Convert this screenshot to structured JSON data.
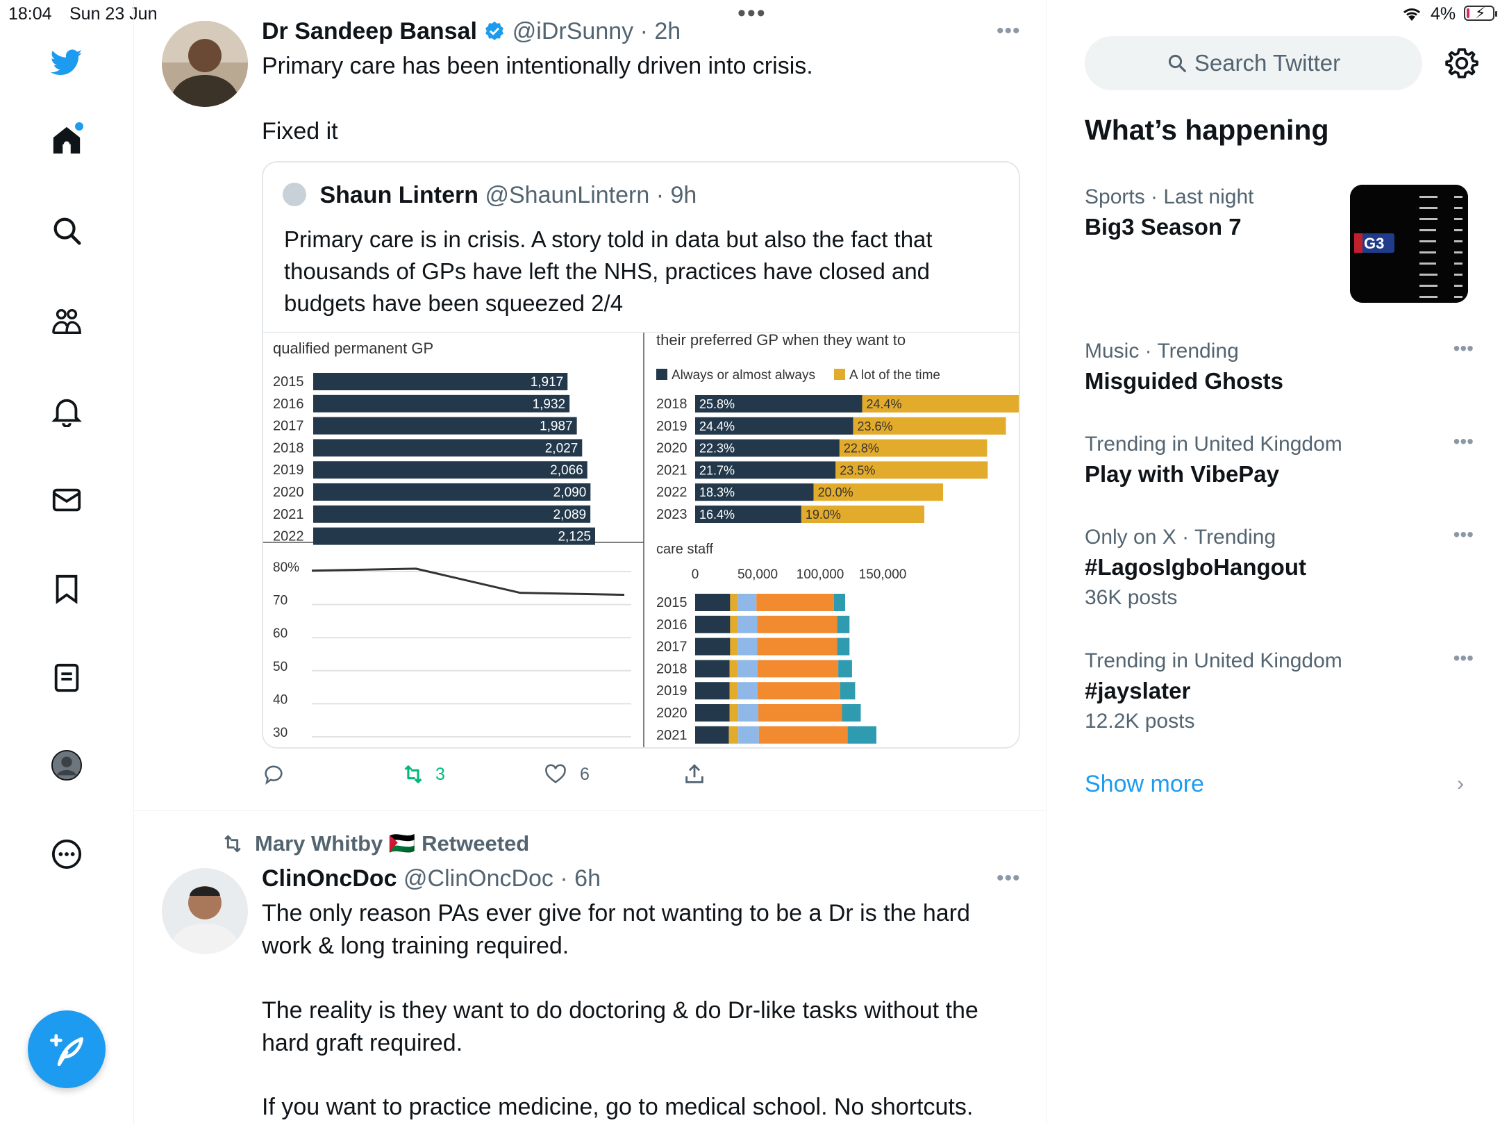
{
  "status_bar": {
    "time": "18:04",
    "date": "Sun 23 Jun",
    "battery": "4%",
    "battery_level": 0.04
  },
  "nav": {
    "compose_label": "Post"
  },
  "tweet1": {
    "name": "Dr Sandeep Bansal",
    "handle": "@iDrSunny",
    "time": "· 2h",
    "text_line1": "Primary care has been intentionally driven into crisis.",
    "text_line2": "Fixed it",
    "quote": {
      "name": "Shaun Lintern",
      "handle": "@ShaunLintern",
      "time": "· 9h",
      "text": "Primary care is in crisis. A story told in data but also the fact that thousands of GPs have left the NHS, practices have closed and budgets have been squeezed 2/4"
    },
    "retweets": "3",
    "likes": "6"
  },
  "tweet2": {
    "retweeted_by": "Mary Whitby",
    "flag": "🇵🇸",
    "retweeted_label": "Retweeted",
    "name": "ClinOncDoc",
    "handle": "@ClinOncDoc",
    "time": "· 6h",
    "p1a": "The only reason PAs ever give for not wanting to be a Dr is the hard",
    "p1b": "work & long training required.",
    "p2a": "The reality is they want to do doctoring & do Dr-like tasks without the",
    "p2b": "hard graft required.",
    "p3": "If you want to practice medicine, go to medical school. No shortcuts."
  },
  "right": {
    "search_placeholder": "Search Twitter",
    "title": "What’s happening",
    "trends": [
      {
        "meta": "Sports · Last night",
        "name": "Big3 Season 7",
        "posts": ""
      },
      {
        "meta": "Music · Trending",
        "name": "Misguided Ghosts",
        "posts": ""
      },
      {
        "meta": "Trending in United Kingdom",
        "name": "Play with VibePay",
        "posts": ""
      },
      {
        "meta": "Only on X · Trending",
        "name": "#LagosIgboHangout",
        "posts": "36K posts"
      },
      {
        "meta": "Trending in United Kingdom",
        "name": "#jayslater",
        "posts": "12.2K posts"
      }
    ],
    "show_more": "Show more",
    "big3_logo": "G3"
  },
  "chart_data": [
    {
      "type": "bar",
      "title": "qualified permanent GP",
      "categories": [
        "2015",
        "2016",
        "2017",
        "2018",
        "2019",
        "2020",
        "2021",
        "2022"
      ],
      "values": [
        1917,
        1932,
        1987,
        2027,
        2066,
        2090,
        2089,
        2125
      ],
      "labels": [
        "1,917",
        "1,932",
        "1,987",
        "2,027",
        "2,066",
        "2,090",
        "2,089",
        "2,125"
      ],
      "color": "#23394b"
    },
    {
      "type": "bar",
      "title": "their preferred GP when they want to",
      "categories": [
        "2018",
        "2019",
        "2020",
        "2021",
        "2022",
        "2023"
      ],
      "series": [
        {
          "name": "Always or almost always",
          "values": [
            25.8,
            24.4,
            22.3,
            21.7,
            18.3,
            16.4
          ],
          "labels": [
            "25.8%",
            "24.4%",
            "22.3%",
            "21.7%",
            "18.3%",
            "16.4%"
          ],
          "color": "#23394b"
        },
        {
          "name": "A lot of the time",
          "values": [
            24.4,
            23.6,
            22.8,
            23.5,
            20.0,
            19.0
          ],
          "labels": [
            "24.4%",
            "23.6%",
            "22.8%",
            "23.5%",
            "20.0%",
            "19.0%"
          ],
          "color": "#e3ab2b"
        }
      ]
    },
    {
      "type": "line",
      "y_ticks": [
        "80%",
        "70",
        "60",
        "50",
        "40",
        "30"
      ],
      "ylim": [
        30,
        80
      ],
      "values": [
        79,
        79.6,
        72.3,
        71.7
      ],
      "grid": true
    },
    {
      "type": "bar",
      "title": "care staff",
      "x_ticks": [
        "0",
        "50,000",
        "100,000",
        "150,000"
      ],
      "xlim": [
        0,
        150000
      ],
      "categories": [
        "2015",
        "2016",
        "2017",
        "2018",
        "2019",
        "2020",
        "2021"
      ],
      "series": [
        {
          "name": "",
          "values": [
            28000,
            28000,
            28000,
            27500,
            27500,
            27500,
            27000
          ],
          "color": "#23394b"
        },
        {
          "name": "",
          "values": [
            6000,
            6000,
            6000,
            6500,
            6500,
            7000,
            7500
          ],
          "color": "#e3ab2b"
        },
        {
          "name": "",
          "values": [
            15000,
            15500,
            15500,
            16000,
            16000,
            16000,
            16500
          ],
          "color": "#8fb8e8"
        },
        {
          "name": "",
          "values": [
            62000,
            64000,
            64000,
            64500,
            66000,
            67000,
            71000
          ],
          "color": "#f28a30"
        },
        {
          "name": "",
          "values": [
            9000,
            10000,
            10000,
            11000,
            12000,
            15000,
            23000
          ],
          "color": "#2e9bb0"
        }
      ]
    }
  ]
}
